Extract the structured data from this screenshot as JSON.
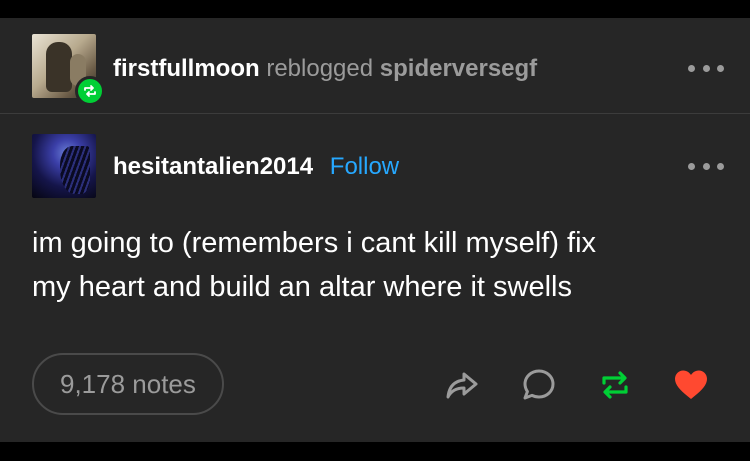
{
  "reblog_header": {
    "reblogger": "firstfullmoon",
    "action": "reblogged",
    "original_poster": "spiderversegf"
  },
  "post": {
    "author": "hesitantalien2014",
    "follow_label": "Follow",
    "text_lines": [
      "im going to (remembers i cant kill myself) fix",
      "my heart and build an altar where it swells"
    ]
  },
  "footer": {
    "notes": "9,178 notes"
  },
  "icons": {
    "reblog_badge": "reblog-icon",
    "more": "more-horizontal-icon",
    "share": "share-icon",
    "comment": "comment-icon",
    "reblog": "reblog-icon",
    "like": "heart-icon"
  },
  "colors": {
    "background": "#262626",
    "follow": "#26a8ff",
    "reblog_green": "#00cf35",
    "like_red": "#ff4930",
    "muted": "#9b9b9b"
  }
}
